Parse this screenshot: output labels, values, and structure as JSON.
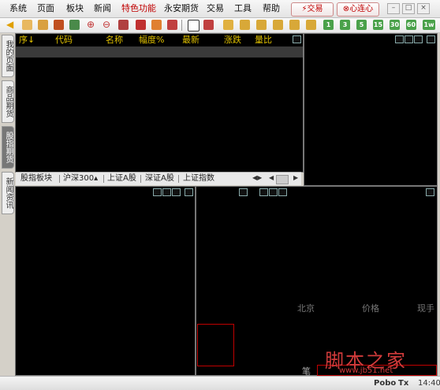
{
  "menubar": {
    "items": [
      {
        "label": "系统"
      },
      {
        "label": "页面"
      },
      {
        "label": "板块"
      },
      {
        "label": "新闻"
      },
      {
        "label": "特色功能"
      },
      {
        "label": "永安期货"
      },
      {
        "label": "交易"
      },
      {
        "label": "工具"
      },
      {
        "label": "帮助"
      }
    ],
    "trade_button": "交易",
    "connect_button": "心连心"
  },
  "toolbar": {
    "number_buttons": [
      "1",
      "3",
      "5",
      "15",
      "30",
      "60",
      "1w"
    ]
  },
  "sidebar": {
    "tabs": [
      "我的页面",
      "商品期货",
      "股指期货",
      "新闻资讯"
    ],
    "active": "股指期货"
  },
  "quote_list": {
    "columns": [
      "序↓",
      "代码",
      "名称",
      "幅度%",
      "最新",
      "涨跌",
      "量比"
    ]
  },
  "bottom_tabs": {
    "items": [
      "股指板块",
      "沪深300",
      "上证A股",
      "深证A股",
      "上证指数"
    ]
  },
  "market_panel": {
    "labels": [
      "北京",
      "价格",
      "现手"
    ],
    "side_char": "笔"
  },
  "statusbar": {
    "brand": "Pobo",
    "icon_text": "Tx",
    "time": "14:40"
  },
  "watermark": {
    "title": "脚本之家",
    "url": "www.jb51.net"
  },
  "colors": {
    "panel_bg": "#000000",
    "header_text": "#e0c000",
    "accent_red": "#c00000"
  }
}
